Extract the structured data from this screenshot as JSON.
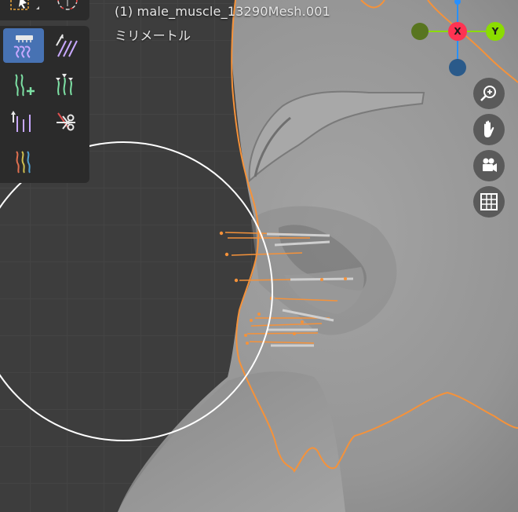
{
  "viewport": {
    "object_name": "(1) male_muscle_13290Mesh.001",
    "units": "ミリメートル"
  },
  "gizmo": {
    "x_label": "X",
    "y_label": "Y",
    "x_color": "#ff3352",
    "y_color": "#8bdc00",
    "z_color": "#2890ff"
  },
  "tools": [
    {
      "name": "comb",
      "active": true
    },
    {
      "name": "smooth",
      "active": false
    },
    {
      "name": "add",
      "active": false
    },
    {
      "name": "puff",
      "active": false
    },
    {
      "name": "length",
      "active": false
    },
    {
      "name": "cut",
      "active": false
    },
    {
      "name": "weight",
      "active": false
    }
  ],
  "nav_buttons": [
    "zoom-icon",
    "pan-hand-icon",
    "camera-icon",
    "grid-icon"
  ],
  "colors": {
    "active_tool": "#4772b3",
    "selection_outline": "#f5923a",
    "brush_circle": "#ffffff"
  }
}
